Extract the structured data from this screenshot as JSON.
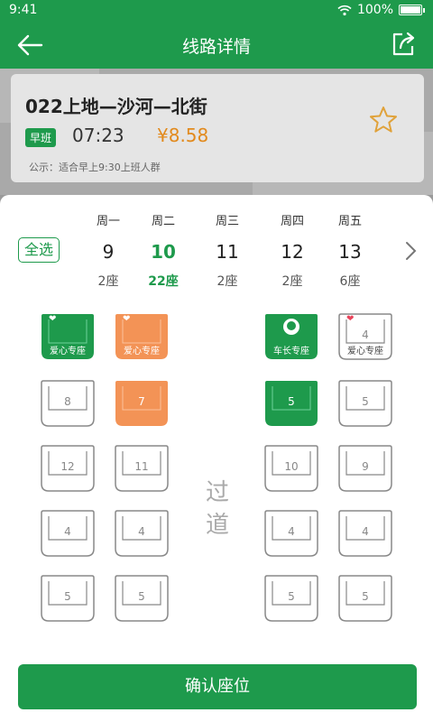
{
  "status": {
    "time": "9:41",
    "battery": "100%",
    "battery_level": 1.0
  },
  "nav": {
    "title": "线路详情"
  },
  "route": {
    "name": "022上地—沙河—北街",
    "shift": "早班",
    "time": "07:23",
    "price": "¥8.58",
    "notice": "公示：适合早上9:30上班人群"
  },
  "select_all": "全选",
  "days": [
    {
      "weekday": "周一",
      "date": "9",
      "seats": "2座",
      "active": false
    },
    {
      "weekday": "周二",
      "date": "10",
      "seats": "22座",
      "active": true
    },
    {
      "weekday": "周三",
      "date": "11",
      "seats": "2座",
      "active": false
    },
    {
      "weekday": "周四",
      "date": "12",
      "seats": "2座",
      "active": false
    },
    {
      "weekday": "周五",
      "date": "13",
      "seats": "6座",
      "active": false
    }
  ],
  "seats": {
    "r1": {
      "s1_label": "爱心专座",
      "s2_label": "爱心专座",
      "s3_label": "车长专座",
      "s4_num": "4",
      "s4_label": "爱心专座"
    },
    "r2": {
      "s1_num": "8",
      "s2_num": "7",
      "s3_num": "5",
      "s4_num": "5"
    },
    "r3": {
      "s1_num": "12",
      "s2_num": "11",
      "s3_num": "10",
      "s4_num": "9"
    },
    "r4": {
      "s1_num": "4",
      "s2_num": "4",
      "s3_num": "4",
      "s4_num": "4"
    },
    "r5": {
      "s1_num": "5",
      "s2_num": "5",
      "s3_num": "5",
      "s4_num": "5"
    }
  },
  "aisle": {
    "line1": "过",
    "line2": "道"
  },
  "confirm_button": "确认座位",
  "colors": {
    "primary": "#1e9a4c",
    "orange": "#f39356",
    "price": "#e28a1d",
    "star": "#e0a23a"
  },
  "icons": [
    "back-arrow-icon",
    "share-icon",
    "star-icon",
    "chevron-right-icon",
    "heart-icon",
    "driver-icon",
    "wifi-icon",
    "battery-icon"
  ]
}
